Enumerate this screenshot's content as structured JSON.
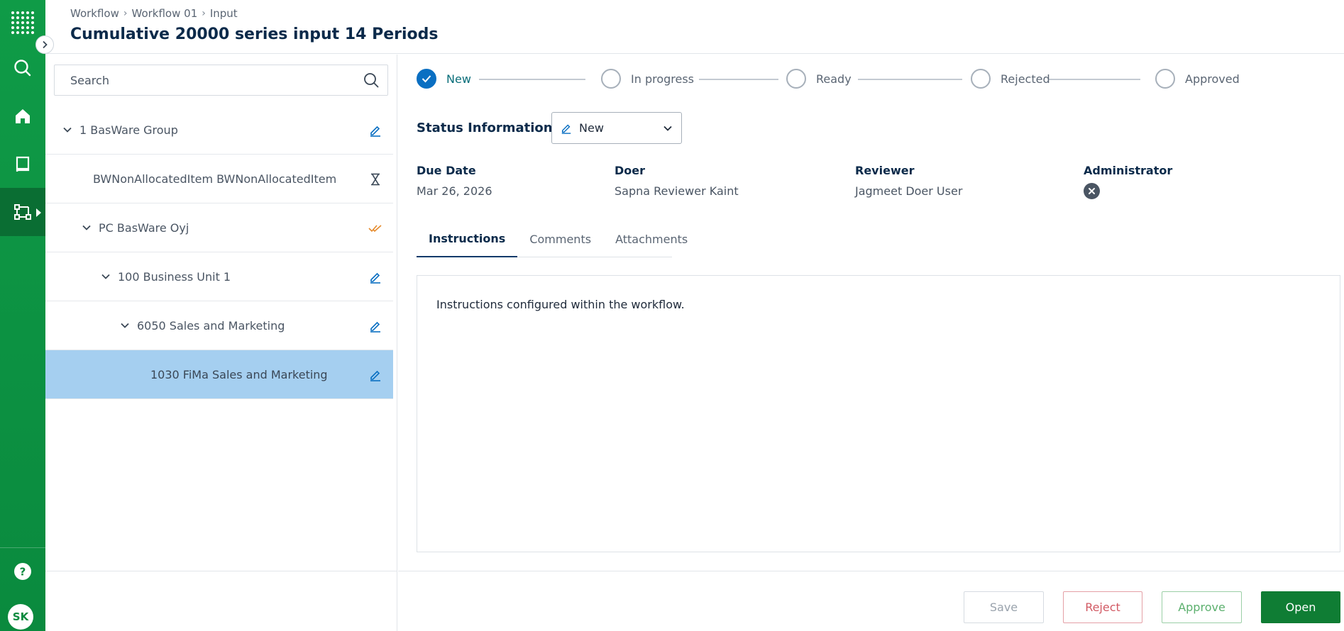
{
  "colors": {
    "rail": "#0a8a3e",
    "accent_blue": "#0a6fc2",
    "selected_row": "#a5cff0",
    "open_button": "#0f7d34",
    "reject": "#d25a64",
    "approve": "#5cb06e",
    "pending_icon": "#e58a2c"
  },
  "rail": {
    "items": [
      {
        "icon": "app-grid-icon"
      },
      {
        "icon": "search-icon"
      },
      {
        "icon": "home-icon"
      },
      {
        "icon": "book-icon"
      },
      {
        "icon": "workflow-icon",
        "active": true
      },
      {
        "icon": "help-icon"
      }
    ],
    "avatar": "SK"
  },
  "header": {
    "breadcrumb": [
      "Workflow",
      "Workflow 01",
      "Input"
    ],
    "title": "Cumulative 20000 series input 14 Periods"
  },
  "tree": {
    "search_placeholder": "Search",
    "rows": [
      {
        "label": "1 BasWare Group",
        "depth": 0,
        "expanded": true,
        "icon": "edit-icon"
      },
      {
        "label": "BWNonAllocatedItem BWNonAllocatedItem",
        "depth": 1,
        "expanded": false,
        "icon": "hourglass-icon"
      },
      {
        "label": "PC BasWare Oyj",
        "depth": 1,
        "expanded": true,
        "icon": "double-check-icon"
      },
      {
        "label": "100 Business Unit 1",
        "depth": 2,
        "expanded": true,
        "icon": "edit-icon"
      },
      {
        "label": "6050 Sales and Marketing",
        "depth": 3,
        "expanded": true,
        "icon": "edit-icon"
      },
      {
        "label": "1030 FiMa Sales and Marketing",
        "depth": 4,
        "expanded": false,
        "icon": "edit-icon",
        "selected": true
      }
    ]
  },
  "stepper": {
    "steps": [
      {
        "label": "New",
        "state": "done"
      },
      {
        "label": "In progress",
        "state": "pending"
      },
      {
        "label": "Ready",
        "state": "pending"
      },
      {
        "label": "Rejected",
        "state": "pending"
      },
      {
        "label": "Approved",
        "state": "pending"
      }
    ]
  },
  "status": {
    "label": "Status Information",
    "selected": "New"
  },
  "meta": {
    "due_date": {
      "label": "Due Date",
      "value": "Mar 26, 2026"
    },
    "doer": {
      "label": "Doer",
      "value": "Sapna Reviewer Kaint"
    },
    "reviewer": {
      "label": "Reviewer",
      "value": "Jagmeet Doer User"
    },
    "administrator": {
      "label": "Administrator",
      "value": ""
    }
  },
  "tabs": {
    "items": [
      "Instructions",
      "Comments",
      "Attachments"
    ],
    "active": 0,
    "instructions_text": "Instructions configured within the workflow."
  },
  "actions": {
    "save": "Save",
    "reject": "Reject",
    "approve": "Approve",
    "open": "Open"
  }
}
